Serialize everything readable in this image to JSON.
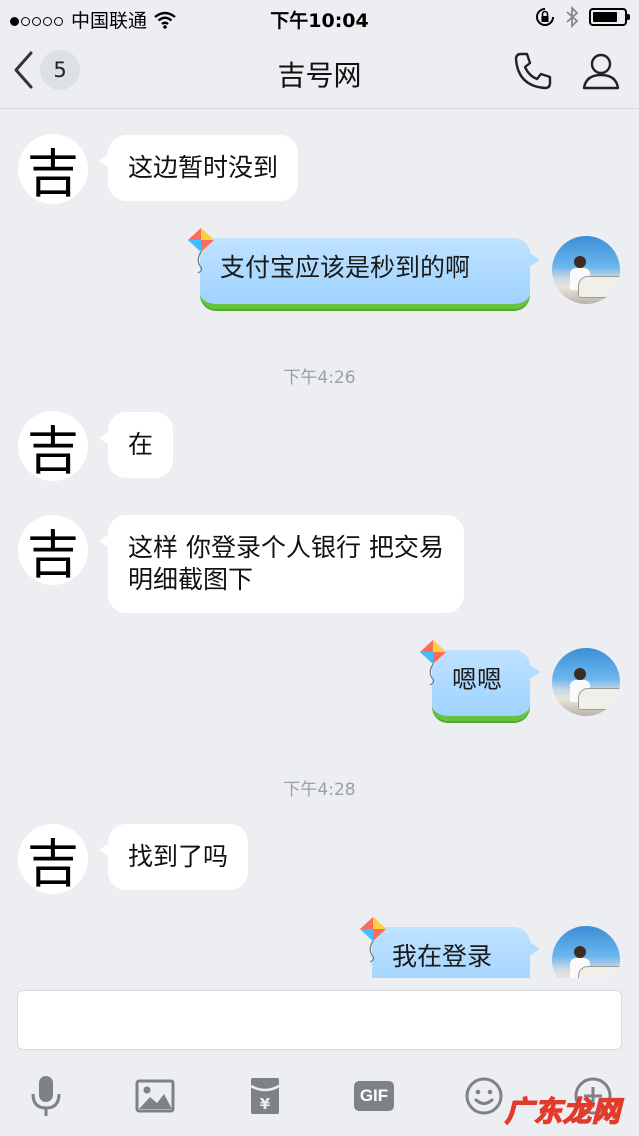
{
  "status_bar": {
    "carrier": "中国联通",
    "time": "下午10:04"
  },
  "nav": {
    "back_badge": "5",
    "title": "吉号网"
  },
  "messages": [
    {
      "side": "in",
      "avatar_char": "吉",
      "text": "这边暂时没到"
    },
    {
      "side": "out",
      "text": "支付宝应该是秒到的啊"
    },
    {
      "type": "time",
      "text": "下午4:26"
    },
    {
      "side": "in",
      "avatar_char": "吉",
      "text": "在"
    },
    {
      "side": "in",
      "avatar_char": "吉",
      "text_line1": "这样 你登录个人银行 把交易",
      "text_line2": "明细截图下"
    },
    {
      "side": "out",
      "text": "嗯嗯"
    },
    {
      "type": "time",
      "text": "下午4:28"
    },
    {
      "side": "in",
      "avatar_char": "吉",
      "text": "找到了吗"
    },
    {
      "side": "out",
      "text": "我在登录"
    }
  ],
  "input": {
    "placeholder": ""
  },
  "toolbar": {
    "gif_label": "GIF",
    "icons": [
      "microphone-icon",
      "image-icon",
      "red-packet-icon",
      "gif-icon",
      "emoji-icon",
      "plus-icon"
    ]
  },
  "watermark": "广东龙网",
  "colors": {
    "background": "#eceef2",
    "bubble_in": "#ffffff",
    "bubble_out": "#a6d6ff",
    "bubble_out_grass": "#66c23a"
  }
}
